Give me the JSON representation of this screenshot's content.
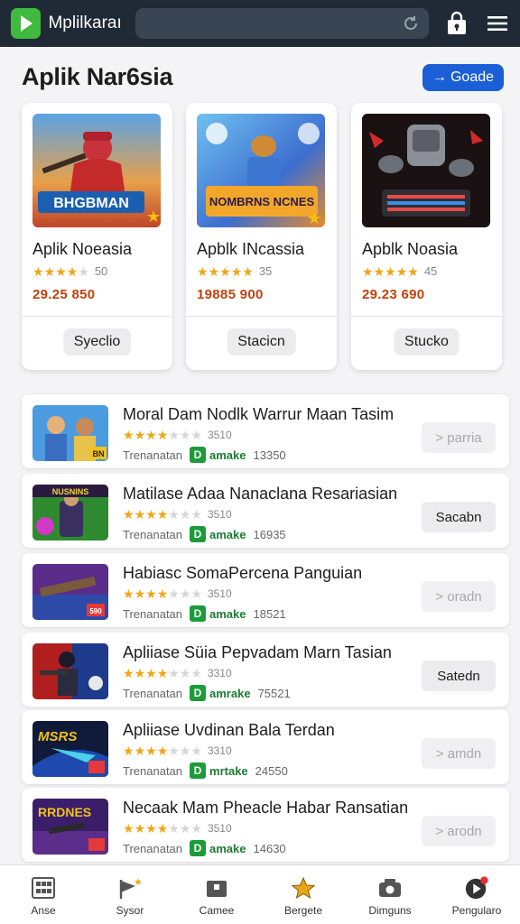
{
  "app": {
    "name": "Mplilkaraı"
  },
  "header": {
    "title": "Aplik Nar6sia",
    "guide_button": "Goade"
  },
  "featured": [
    {
      "name": "Aplik Noeasia",
      "art_text": "BHGBMAN",
      "rating": 3.5,
      "count": "50",
      "price": "29.25 850",
      "button": "Syeclio"
    },
    {
      "name": "Apblk INcassia",
      "art_text": "NOMBRNS NCNES",
      "rating": 5,
      "count": "35",
      "price": "19885 900",
      "button": "Stacicn"
    },
    {
      "name": "Apblk Noasia",
      "art_text": "",
      "rating": 5,
      "count": "45",
      "price": "29.23 690",
      "button": "Stucko"
    }
  ],
  "list": [
    {
      "title": "Moral Dam Nodlk Warrur Maan Tasim",
      "rating": 3.5,
      "count": "3510",
      "publisher": "Trenanatan",
      "download_label": "amake",
      "downloads": "13350",
      "button": "> parria",
      "disabled": true,
      "art_text": "BN"
    },
    {
      "title": "Matilase Adaa Nanaclana Resariasian",
      "rating": 3.5,
      "count": "3510",
      "publisher": "Trenanatan",
      "download_label": "amake",
      "downloads": "16935",
      "button": "Sacabn",
      "disabled": false,
      "art_text": "NUSNINS"
    },
    {
      "title": "Habiasc SomaPercena Panguian",
      "rating": 3.5,
      "count": "3510",
      "publisher": "Trenanatan",
      "download_label": "amake",
      "downloads": "18521",
      "button": "> oradn",
      "disabled": true,
      "art_text": "590"
    },
    {
      "title": "Apliiase Süia Pepvadam Marn Tasian",
      "rating": 3.5,
      "count": "3310",
      "publisher": "Trenanatan",
      "download_label": "amrake",
      "downloads": "75521",
      "button": "Satedn",
      "disabled": false,
      "art_text": ""
    },
    {
      "title": "Apliiase Uvdinan Bala Terdan",
      "rating": 3.5,
      "count": "3310",
      "publisher": "Trenanatan",
      "download_label": "mrtake",
      "downloads": "24550",
      "button": "> amdn",
      "disabled": true,
      "art_text": "MSRS"
    },
    {
      "title": "Necaak Mam Pheacle Habar Ransatian",
      "rating": 3.5,
      "count": "3510",
      "publisher": "Trenanatan",
      "download_label": "amake",
      "downloads": "14630",
      "button": "> arodn",
      "disabled": true,
      "art_text": "RRDNES"
    }
  ],
  "bottom_nav": [
    {
      "label": "Anse",
      "icon": "grid-icon"
    },
    {
      "label": "Sysor",
      "icon": "flag-star-icon"
    },
    {
      "label": "Camee",
      "icon": "briefcase-icon"
    },
    {
      "label": "Bergete",
      "icon": "star-icon"
    },
    {
      "label": "Dimguns",
      "icon": "camera-icon"
    },
    {
      "label": "Pengularo",
      "icon": "play-badge-icon"
    }
  ],
  "colors": {
    "topbar": "#1f2a36",
    "accent": "#1a5fd6",
    "logo": "#3fba3f",
    "price": "#c2410c",
    "download": "#1d9b3a"
  }
}
